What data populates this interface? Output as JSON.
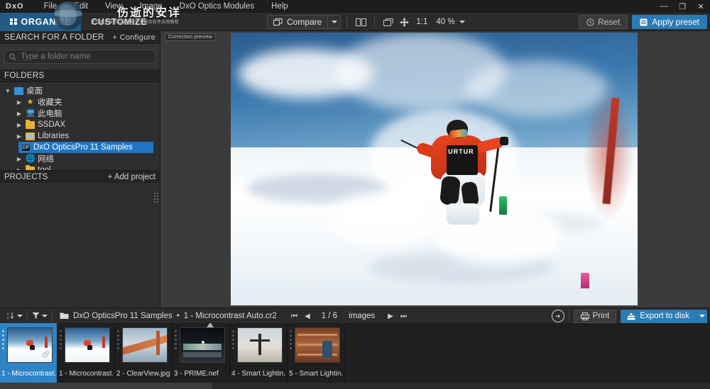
{
  "app": {
    "brand": "DxO",
    "menu": [
      "File",
      "Edit",
      "View",
      "Image",
      "DxO Optics Modules",
      "Help"
    ],
    "window_controls": {
      "minimize": "—",
      "restore": "❐",
      "close": "✕"
    }
  },
  "watermark": {
    "chinese_title": "伤逝的安详",
    "subtitle": "关注更多最新与最新软件资源及软件应用教程"
  },
  "tabs": [
    {
      "label": "ORGANIZE",
      "active": true
    },
    {
      "label": "CUSTOMIZE",
      "active": false
    }
  ],
  "toolbar": {
    "compare_label": "Compare",
    "side_by_side_icon": "split-view-icon",
    "single_view_icon": "single-view-icon",
    "pan_icon": "pan-move-icon",
    "one_to_one": "1:1",
    "zoom_value": "40 %",
    "reset_label": "Reset",
    "apply_preset_label": "Apply preset"
  },
  "left_panel": {
    "search_header": "SEARCH FOR A FOLDER",
    "configure_label": "+ Configure",
    "search_placeholder": "Type a folder name",
    "search_value": "",
    "folders_header": "FOLDERS",
    "tree": [
      {
        "label": "桌面",
        "icon": "desktop-folder-icon",
        "depth": 0,
        "expanded": true,
        "selected": false
      },
      {
        "label": "收藏夹",
        "icon": "favorites-star-icon",
        "depth": 1,
        "expanded": false,
        "selected": false
      },
      {
        "label": "此电脑",
        "icon": "this-pc-icon",
        "depth": 1,
        "expanded": false,
        "selected": false
      },
      {
        "label": "SSDAX",
        "icon": "folder-icon",
        "depth": 1,
        "expanded": false,
        "selected": false
      },
      {
        "label": "Libraries",
        "icon": "libraries-icon",
        "depth": 1,
        "expanded": false,
        "selected": false
      },
      {
        "label": "DxO OpticsPro 11 Samples",
        "icon": "dxo-folder-icon",
        "depth": 1,
        "expanded": false,
        "selected": true
      },
      {
        "label": "网络",
        "icon": "network-icon",
        "depth": 1,
        "expanded": false,
        "selected": false
      },
      {
        "label": "tool",
        "icon": "folder-icon",
        "depth": 1,
        "expanded": false,
        "selected": false
      }
    ],
    "projects_header": "PROJECTS",
    "add_project_label": "+ Add project"
  },
  "viewer": {
    "correction_preview_label": "Correction preview"
  },
  "bottom_bar": {
    "sort_icon": "sort-az-icon",
    "filter_icon": "filter-funnel-icon",
    "breadcrumb_folder": "DxO OpticsPro 11 Samples",
    "breadcrumb_separator": "•",
    "breadcrumb_file": "1 - Microcontrast Auto.cr2",
    "nav_first": "⏮",
    "nav_prev": "◀",
    "counter": "1 / 6",
    "counter_unit": "images",
    "nav_next": "▶",
    "nav_last": "⏭",
    "export_circle_icon": "export-arrow-circle-icon",
    "print_label": "Print",
    "export_label": "Export to disk"
  },
  "filmstrip": {
    "items": [
      {
        "label": "1 - Microcontrast...",
        "selected": true,
        "checked": true,
        "art": "t-ski",
        "marker": false
      },
      {
        "label": "1 - Microcontrast...",
        "selected": false,
        "checked": false,
        "art": "t-ski",
        "marker": false
      },
      {
        "label": "2 - ClearView.jpg",
        "selected": false,
        "checked": false,
        "art": "t-bridge",
        "marker": false
      },
      {
        "label": "3 - PRIME.nef",
        "selected": false,
        "checked": false,
        "art": "t-prime",
        "marker": true
      },
      {
        "label": "4 - Smart Lightin...",
        "selected": false,
        "checked": false,
        "art": "t-beach",
        "marker": false
      },
      {
        "label": "5 - Smart Lightin...",
        "selected": false,
        "checked": false,
        "art": "t-shelf",
        "marker": false
      }
    ]
  },
  "colors": {
    "accent": "#2b7cb5",
    "selection": "#1f76c4",
    "tab_active": "#1f5c86",
    "chrome_dark": "#1d1d1d",
    "panel": "#2e2e2e"
  }
}
